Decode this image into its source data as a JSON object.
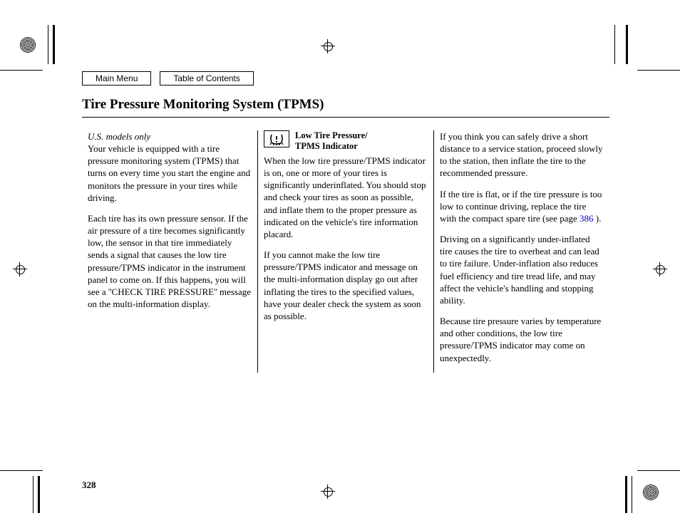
{
  "nav": {
    "main": "Main Menu",
    "toc": "Table of Contents"
  },
  "title": "Tire Pressure Monitoring System (TPMS)",
  "pageNumber": "328",
  "col1": {
    "note": "U.S. models only",
    "p1": "Your vehicle is equipped with a tire pressure monitoring system (TPMS) that turns on every time you start the engine and monitors the pressure in your tires while driving.",
    "p2": "Each tire has its own pressure sensor. If the air pressure of a tire becomes significantly low, the sensor in that tire immediately sends a signal that causes the low tire pressure/TPMS indicator in the instrument panel to come on. If this happens, you will see a ''CHECK TIRE PRESSURE'' message on the multi-information display."
  },
  "col2": {
    "hdr1": "Low Tire Pressure/",
    "hdr2": "TPMS Indicator",
    "p1": "When the low tire pressure/TPMS indicator is on, one or more of your tires is significantly underinflated. You should stop and check your tires as soon as possible, and inflate them to the proper pressure as indicated on the vehicle's tire information placard.",
    "p2": "If you cannot make the low tire pressure/TPMS indicator and message on the multi-information display go out after inflating the tires to the specified values, have your dealer check the system as soon as possible."
  },
  "col3": {
    "p1": "If you think you can safely drive a short distance to a service station, proceed slowly to the station, then inflate the tire to the recommended pressure.",
    "p2a": "If the tire is flat, or if the tire pressure is too low to continue driving, replace the tire with the compact spare tire (see page ",
    "p2link": "386",
    "p2b": " ).",
    "p3": "Driving on a significantly under-inflated tire causes the tire to overheat and can lead to tire failure. Under-inflation also reduces fuel efficiency and tire tread life, and may affect the vehicle's handling and stopping ability.",
    "p4": "Because tire pressure varies by temperature and other conditions, the low tire pressure/TPMS indicator may come on unexpectedly."
  }
}
